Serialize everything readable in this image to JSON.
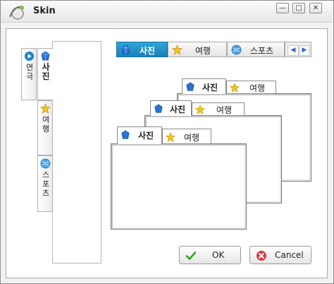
{
  "window": {
    "title": "Skin",
    "controls": {
      "minimize": "—",
      "maximize": "□",
      "close": "✕"
    }
  },
  "vertical_tabs": [
    {
      "label": "연극",
      "icon": "play-icon",
      "selected": false
    },
    {
      "label": "사진",
      "icon": "gem-icon",
      "selected": true
    },
    {
      "label": "여행",
      "icon": "star-icon",
      "selected": false
    },
    {
      "label": "스포츠",
      "icon": "globe-icon",
      "selected": false
    }
  ],
  "horizontal_tabs": [
    {
      "label": "사진",
      "icon": "gem-icon",
      "selected": true
    },
    {
      "label": "여행",
      "icon": "star-icon",
      "selected": false
    },
    {
      "label": "스포츠",
      "icon": "globe-icon",
      "selected": false
    }
  ],
  "scroll_arrows": {
    "left": "◀",
    "right": "▶"
  },
  "previews": [
    {
      "tab1": "사진",
      "tab2": "여행"
    },
    {
      "tab1": "사진",
      "tab2": "여행"
    },
    {
      "tab1": "사진",
      "tab2": "여행"
    }
  ],
  "buttons": {
    "ok": "OK",
    "cancel": "Cancel"
  },
  "colors": {
    "selected_tab": "#1f8fc9",
    "accent_blue": "#2b67c8",
    "ok_check": "#3a9e2a",
    "cancel_red": "#d8393b"
  }
}
